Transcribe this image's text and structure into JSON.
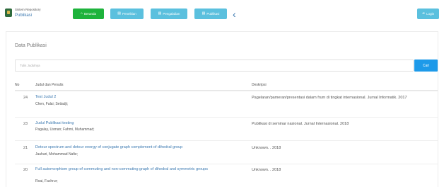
{
  "brand": {
    "line1": "Sistem Repository",
    "line2": "Publikasi"
  },
  "nav": {
    "beranda": "Beranda",
    "penelitian": "Penelitian",
    "pengabdian": "Pengabdian",
    "publikasi": "Publikasi",
    "login": "Login"
  },
  "icons": {
    "home": "home-icon",
    "file": "file-icon",
    "chevron": "chevron-left-icon",
    "login": "sign-in-icon"
  },
  "colors": {
    "accent_green": "#1eb33c",
    "accent_cyan": "#5bc0de",
    "link": "#3a78b0",
    "search_button": "#1e9ae9"
  },
  "page": {
    "title": "Data Publikasi"
  },
  "search": {
    "placeholder": "Tulis Judulnya",
    "button": "Cari"
  },
  "table": {
    "columns": {
      "no": "No",
      "judul": "Judul dan Penulis",
      "deskripsi": "Deskripsi"
    },
    "rows": [
      {
        "no": "24",
        "title": "Test Judul 2",
        "authors": "Chen, Falai; Setiadji;",
        "description": "Pagelaran/pameran/presentasi dalam frum di tingkat internasional. Jurnal Informatik. 2017"
      },
      {
        "no": "23",
        "title": "Judul Publikasi testing",
        "authors": "Pagalay, Usman; Fahmi, Muhammad;",
        "description": "Publikasi di seminar nasional. Jurnal Internasional. 2018"
      },
      {
        "no": "21",
        "title": "Detour spectrum and detour energy of conjugate graph complement of dihedral group",
        "authors": "Jauhari, Mohammad Nafie;",
        "description": "Unknown. . 2018"
      },
      {
        "no": "20",
        "title": "Full automorphism group of commuting and non-commuting graph of dihedral and symmetric groups",
        "authors": "Roai, Fachrur;",
        "description": "Unknown. . 2018"
      }
    ]
  }
}
